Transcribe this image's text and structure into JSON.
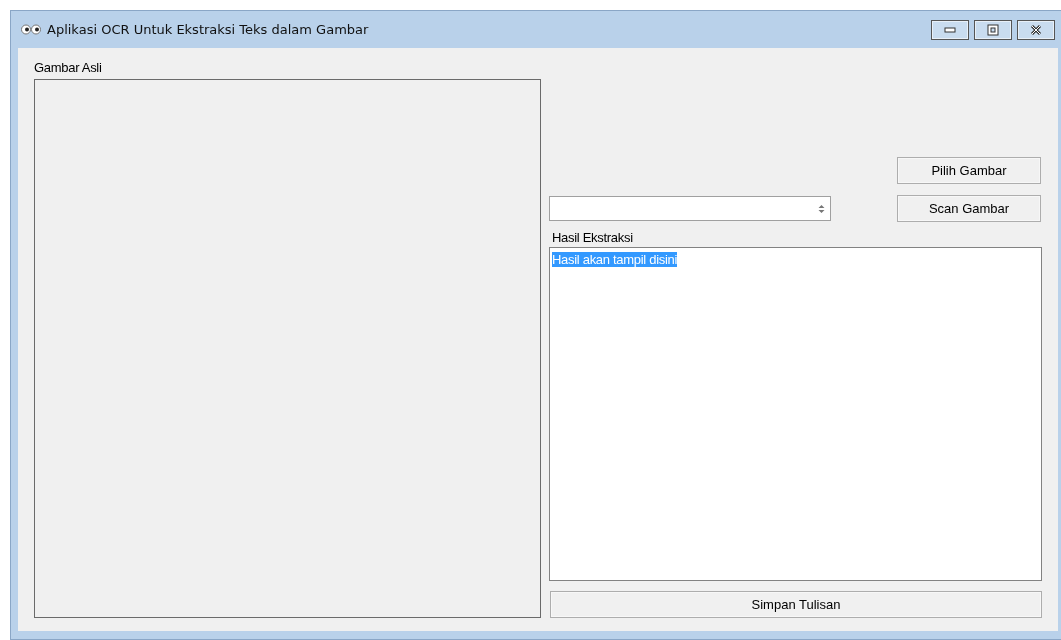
{
  "window": {
    "title": "Aplikasi OCR Untuk Ekstraksi Teks dalam Gambar"
  },
  "image_panel": {
    "label": "Gambar Asli"
  },
  "buttons_top": [
    {
      "label": "Pilih Gambar"
    },
    {
      "label": "Scan Gambar"
    }
  ],
  "selector": {
    "kind": "updown"
  },
  "result": {
    "label": "Hasil Ekstraksi",
    "text": "Hasil akan tampil disini",
    "selected": true
  },
  "save_button": {
    "label": "Simpan Tulisan"
  }
}
